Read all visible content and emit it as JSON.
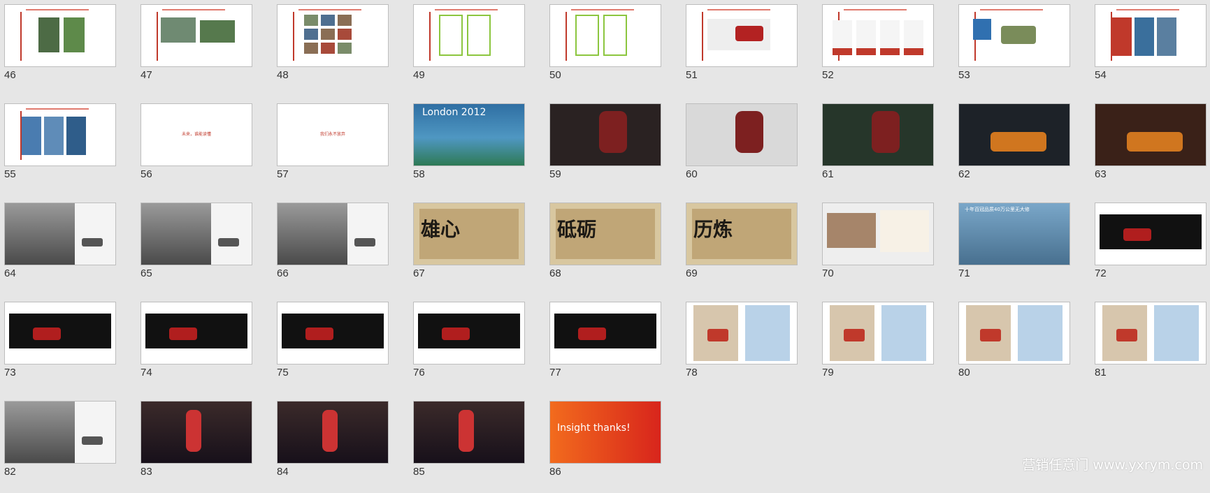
{
  "slides": [
    {
      "number": "46",
      "variant": "doc-poster"
    },
    {
      "number": "47",
      "variant": "doc-2photo"
    },
    {
      "number": "48",
      "variant": "doc-grid"
    },
    {
      "number": "49",
      "variant": "doc-green"
    },
    {
      "number": "50",
      "variant": "doc-green2"
    },
    {
      "number": "51",
      "variant": "doc-car"
    },
    {
      "number": "52",
      "variant": "doc-4cars"
    },
    {
      "number": "53",
      "variant": "doc-suv"
    },
    {
      "number": "54",
      "variant": "doc-3posters"
    },
    {
      "number": "55",
      "variant": "doc-3blue"
    },
    {
      "number": "56",
      "variant": "blank-red",
      "caption": "未来，谁能读懂"
    },
    {
      "number": "57",
      "variant": "blank-red",
      "caption": "我们永不放弃"
    },
    {
      "number": "58",
      "variant": "london",
      "caption": "London 2012"
    },
    {
      "number": "59",
      "variant": "dark-red"
    },
    {
      "number": "60",
      "variant": "athletes"
    },
    {
      "number": "61",
      "variant": "dark-green"
    },
    {
      "number": "62",
      "variant": "car-dark"
    },
    {
      "number": "63",
      "variant": "car-brown"
    },
    {
      "number": "64",
      "variant": "bw-doc"
    },
    {
      "number": "65",
      "variant": "bw-doc2"
    },
    {
      "number": "66",
      "variant": "bw-doc3"
    },
    {
      "number": "67",
      "variant": "sepia",
      "caption": "雄心"
    },
    {
      "number": "68",
      "variant": "sepia",
      "caption": "砥砺"
    },
    {
      "number": "69",
      "variant": "sepia",
      "caption": "历炼"
    },
    {
      "number": "70",
      "variant": "collage"
    },
    {
      "number": "71",
      "variant": "city",
      "caption": "十年百冠品质40万公里无大修"
    },
    {
      "number": "72",
      "variant": "black-band"
    },
    {
      "number": "73",
      "variant": "black-band2"
    },
    {
      "number": "74",
      "variant": "black-band3"
    },
    {
      "number": "75",
      "variant": "black-band4"
    },
    {
      "number": "76",
      "variant": "black-band5"
    },
    {
      "number": "77",
      "variant": "black-band6"
    },
    {
      "number": "78",
      "variant": "print-red"
    },
    {
      "number": "79",
      "variant": "print-2"
    },
    {
      "number": "80",
      "variant": "print-3"
    },
    {
      "number": "81",
      "variant": "print-4"
    },
    {
      "number": "82",
      "variant": "bw-doc4"
    },
    {
      "number": "83",
      "variant": "runner"
    },
    {
      "number": "84",
      "variant": "runner2"
    },
    {
      "number": "85",
      "variant": "runner3"
    },
    {
      "number": "86",
      "variant": "orange",
      "caption": "Insight thanks!"
    }
  ],
  "watermark": "营销任意门 www.yxrym.com",
  "colors": {
    "background": "#e6e6e6",
    "accent": "#c0392b",
    "thumb_border": "#bdbdbd"
  }
}
